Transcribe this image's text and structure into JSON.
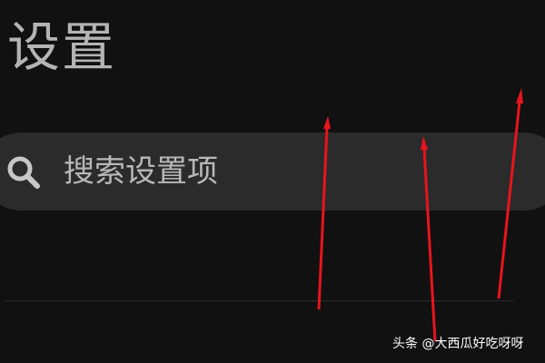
{
  "header": {
    "title": "设置"
  },
  "search": {
    "icon": "search-icon",
    "placeholder": "搜索设置项"
  },
  "watermark": {
    "text": "头条 @大西瓜好吃呀呀"
  },
  "colors": {
    "background": "#111111",
    "search_bar": "#2b2b2b",
    "text": "#b4b4b4",
    "annotation_arrow": "#e8141e"
  }
}
